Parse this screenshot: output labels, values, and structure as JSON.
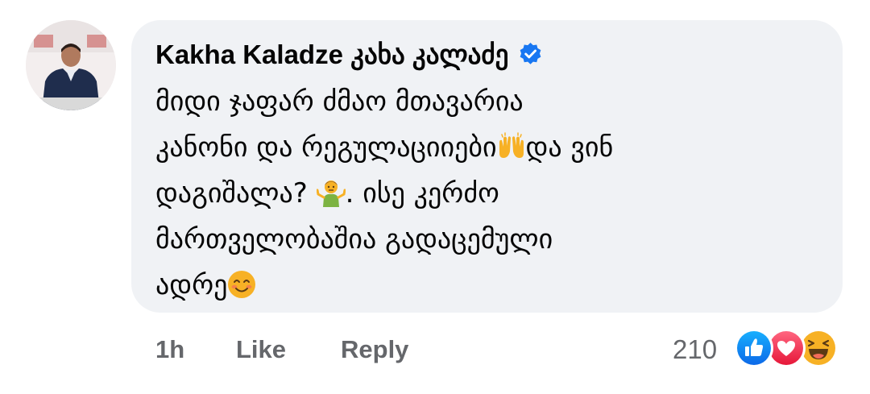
{
  "comment": {
    "author": "Kakha Kaladze კახა კალაძე",
    "verified_icon": "verified-badge-icon",
    "lines": [
      {
        "text": "მიდი ჯაფარ ძმაო მთავარია",
        "emoji_after": null
      },
      {
        "text": "კანონი და რეგულაციიები",
        "emoji_after": "raising-hands-icon",
        "text_after": "და ვინ"
      },
      {
        "text": "დაგიშალა? ",
        "emoji_after": "person-shrugging-icon",
        "text_after": ". ისე  კერძო"
      },
      {
        "text": "მართველობაშია გადაცემული",
        "emoji_after": null
      },
      {
        "text": "ადრე",
        "emoji_after": "smiling-face-icon"
      }
    ],
    "line_1": "მიდი ჯაფარ ძმაო მთავარია",
    "line_2a": "კანონი და რეგულაციიები",
    "line_2b": "და ვინ",
    "line_3a": "დაგიშალა? ",
    "line_3b": ". ისე  კერძო",
    "line_4": "მართველობაშია გადაცემული",
    "line_5": "ადრე"
  },
  "actions": {
    "time": "1h",
    "like_label": "Like",
    "reply_label": "Reply"
  },
  "reactions": {
    "count": "210",
    "types": [
      "like-reaction-icon",
      "love-reaction-icon",
      "haha-reaction-icon"
    ]
  },
  "colors": {
    "bubble_bg": "#f0f2f5",
    "verified": "#1877f2",
    "secondary_text": "#65676b",
    "like_blue": "#1877f2",
    "love_red": "#f33e58",
    "haha_yellow": "#f7b125"
  }
}
